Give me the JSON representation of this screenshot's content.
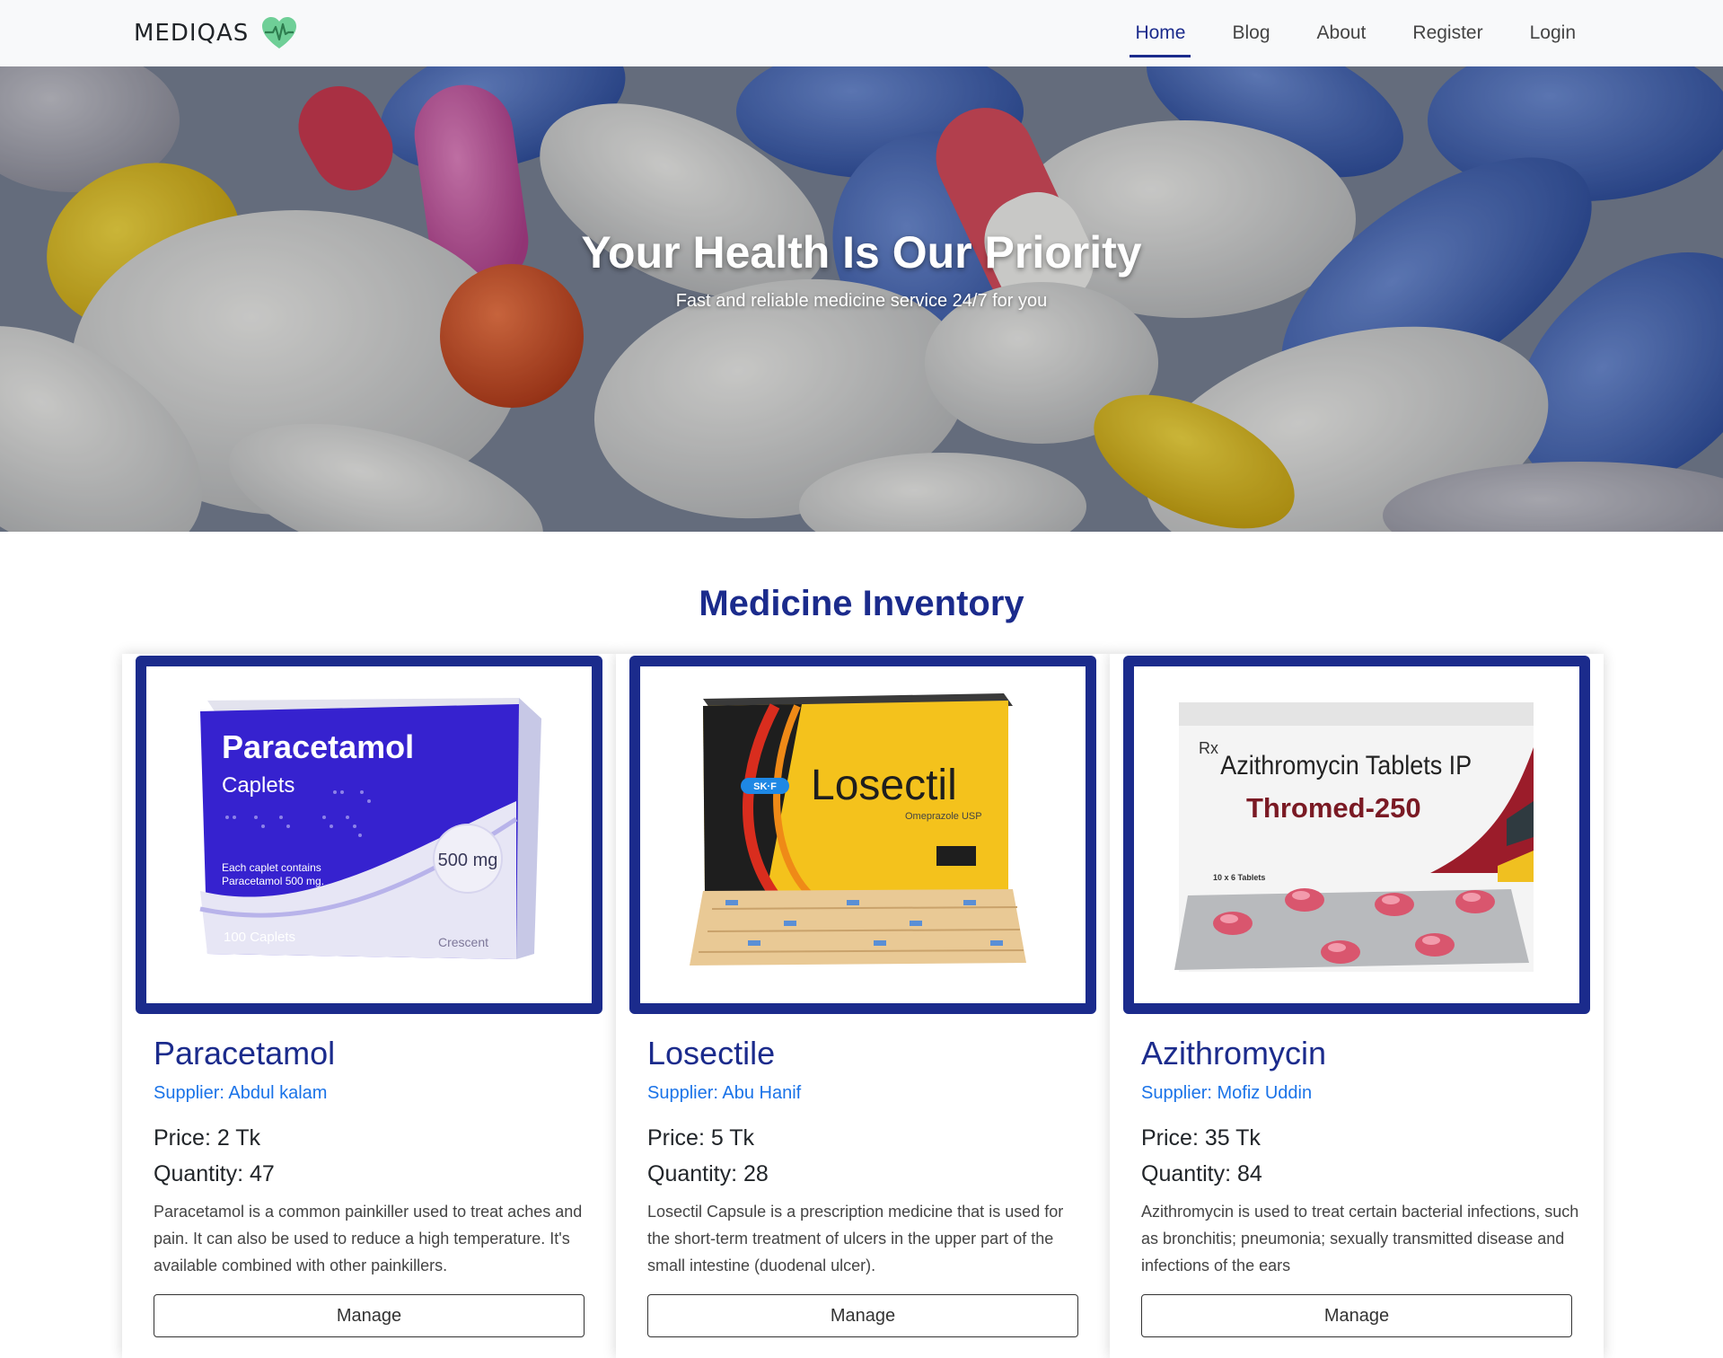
{
  "nav": {
    "brand": "MEDIQAS",
    "links": [
      "Home",
      "Blog",
      "About",
      "Register",
      "Login"
    ],
    "active": "Home"
  },
  "hero": {
    "title": "Your Health Is Our Priority",
    "subtitle": "Fast and reliable medicine service 24/7 for you"
  },
  "inventory": {
    "title": "Medicine Inventory",
    "items": [
      {
        "name": "Paracetamol",
        "supplier": "Supplier: Abdul kalam",
        "price": "Price: 2 Tk",
        "quantity": "Quantity: 47",
        "description": "Paracetamol is a common painkiller used to treat aches and pain. It can also be used to reduce a high temperature. It's available combined with other painkillers.",
        "button": "Manage",
        "box": {
          "brand": "Paracetamol",
          "sub": "Caplets",
          "dose": "500 mg",
          "note1": "Each caplet contains",
          "note2": "Paracetamol 500 mg.",
          "count": "100 Caplets",
          "maker": "Crescent"
        }
      },
      {
        "name": "Losectile",
        "supplier": "Supplier: Abu Hanif",
        "price": "Price: 5 Tk",
        "quantity": "Quantity: 28",
        "description": "Losectil Capsule is a prescription medicine that is used for the short-term treatment of ulcers in the upper part of the small intestine (duodenal ulcer).",
        "button": "Manage",
        "box": {
          "brand": "Losectil",
          "sub": "Omeprazole USP",
          "badge": "SK·F"
        }
      },
      {
        "name": "Azithromycin",
        "supplier": "Supplier: Mofiz Uddin",
        "price": "Price: 35 Tk",
        "quantity": "Quantity: 84",
        "description": "Azithromycin is used to treat certain bacterial infections, such as bronchitis; pneumonia; sexually transmitted disease and infections of the ears",
        "button": "Manage",
        "box": {
          "rx": "Rx",
          "line1": "Azithromycin Tablets IP",
          "line2": "Thromed-250",
          "count": "10 x 6 Tablets"
        }
      }
    ]
  },
  "colors": {
    "primary": "#1b2b8c",
    "supplier": "#1a73e8",
    "navbar": "#f8f9fa"
  }
}
